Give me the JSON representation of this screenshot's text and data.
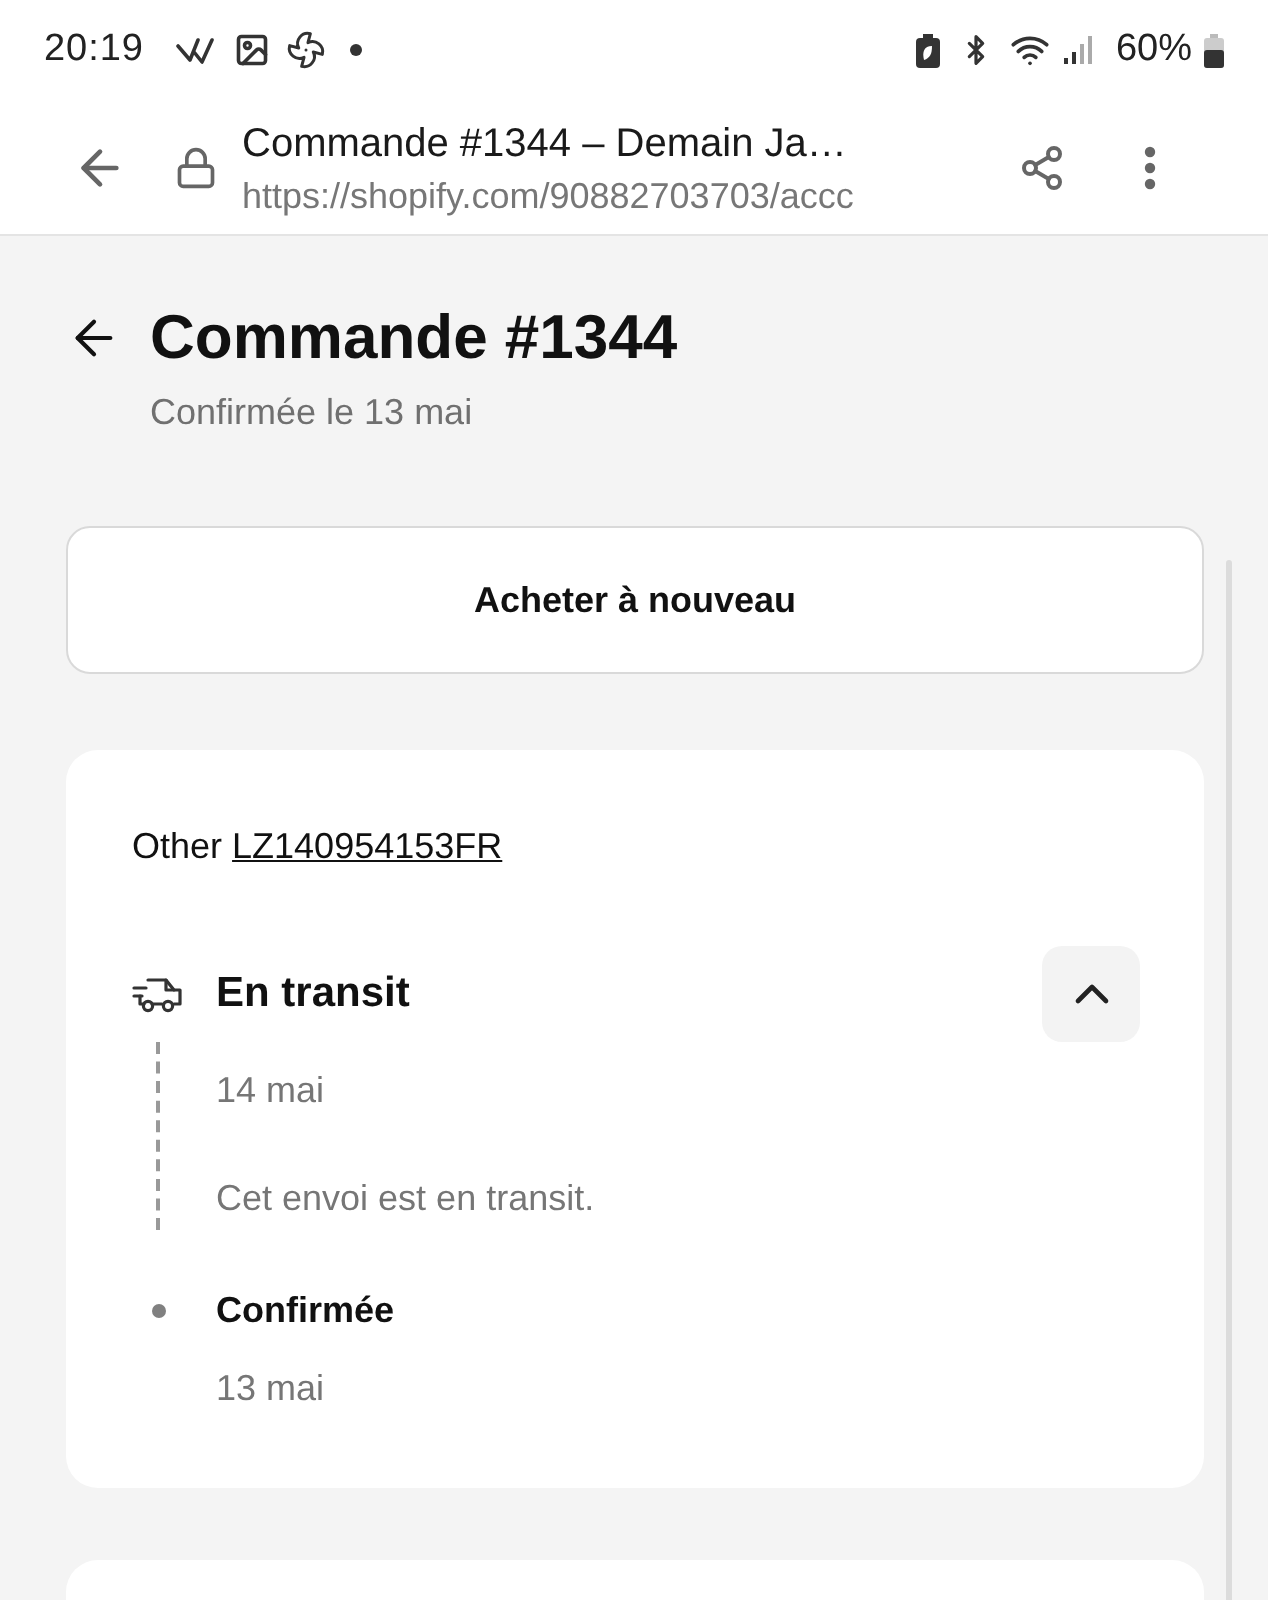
{
  "status_bar": {
    "time": "20:19",
    "battery": "60%"
  },
  "browser_bar": {
    "title": "Commande #1344 – Demain Ja…",
    "url": "https://shopify.com/90882703703/accc"
  },
  "header": {
    "title": "Commande #1344",
    "subtitle": "Confirmée le 13 mai"
  },
  "buy_again_button": {
    "label": "Acheter à nouveau"
  },
  "shipment": {
    "carrier": "Other",
    "tracking_number": "LZ140954153FR",
    "expanded": true,
    "events": [
      {
        "kind": "current",
        "title": "En transit",
        "date": "14 mai",
        "description": "Cet envoi est en transit."
      },
      {
        "kind": "past",
        "title": "Confirmée",
        "date": "13 mai"
      }
    ]
  }
}
